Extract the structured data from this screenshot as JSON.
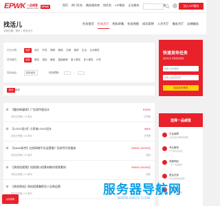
{
  "header": {
    "logo_text": "EPWK",
    "logo_cn": "一品威客",
    "logo_sub": "EPWK.COM",
    "logo_badge": "EPWK",
    "nav": [
      "首页",
      "热门任务",
      "精选服务商",
      "找任务",
      "VIP服务",
      "企业服务",
      "工具指南",
      "移动端"
    ],
    "vip_label": "加入VIP服务"
  },
  "subhead": {
    "title": "找活儿",
    "breadcrumb": "当前位置：首页 > 任务大厅",
    "nav": [
      "任务首页",
      "任务大厅",
      "招标采集",
      "任务地图",
      "成功案例",
      "人才大厅",
      "服务大厅",
      "店铺服务"
    ],
    "active_index": 1
  },
  "filters": {
    "category_label": "行业分类：",
    "categories": [
      "全部",
      "设计",
      "开发",
      "视频",
      "营销",
      "文案",
      "装修",
      "生活",
      "企业服务"
    ],
    "tag_label": "任务模式：",
    "tags": [
      "全部",
      "悬赏",
      "招标",
      "雇佣",
      "直接雇佣",
      "单人悬赏",
      "多人悬赏",
      "计件"
    ],
    "region_label": "发布地区：",
    "region_value": "选择省份",
    "budget_label": "任务预算："
  },
  "sort": {
    "tab_active": "综合",
    "tab_other": "最新"
  },
  "tasks": [
    {
      "title": "【重庆新媒体】广告宣传画设计",
      "meta": "本站已托管 | 1人参与",
      "price": "¥1500",
      "status": "已托管"
    },
    {
      "title": "【LOGO设计】小家电LOGO设计",
      "meta": "本站已托管 | 3人参与",
      "price": "¥800",
      "status": "已托管"
    },
    {
      "title": "【SAAS软件】在线网络平台运营推广及软件开发服务",
      "meta": "本站已托管 | 2人参与",
      "price": "¥5005-10025元",
      "status": "招标"
    },
    {
      "title": "【其他短视频】短视频口径素材制作视频素材",
      "meta": "本站已托管 | 1人参与",
      "price": "¥5005-10025元",
      "status": "招标"
    },
    {
      "title": "【其他网站】网站搭建兼职员人员和运营",
      "meta": "本站已托管 | 2人参与",
      "price": "¥100",
      "status": "招标"
    }
  ],
  "promo": {
    "title": "快速发布任务",
    "subtitle": "发布任务 获取更多服务",
    "input_1": "请输入您的需求",
    "input_2": "请输入您的手机号",
    "button": "免费发布需求"
  },
  "choose": {
    "heading": "选择一品威客",
    "features": [
      {
        "title": "平台保障",
        "desc": "交易资金全程托管保障"
      },
      {
        "title": "专业服务",
        "desc": "千万服务商在线"
      },
      {
        "title": "快速响应",
        "desc": "一对一专属服务"
      },
      {
        "title": "售后无忧",
        "desc": "交易纠纷快速处理"
      },
      {
        "title": "品质优选",
        "desc": "精选优质服务商"
      }
    ]
  },
  "float_kf": "在线客服",
  "watermark": "服务器导航网",
  "watermark_sub": "WWW.NAVS.COM",
  "colors": {
    "brand": "#e8212b",
    "accent": "#ffd200",
    "watermark": "#0aa0e8"
  }
}
